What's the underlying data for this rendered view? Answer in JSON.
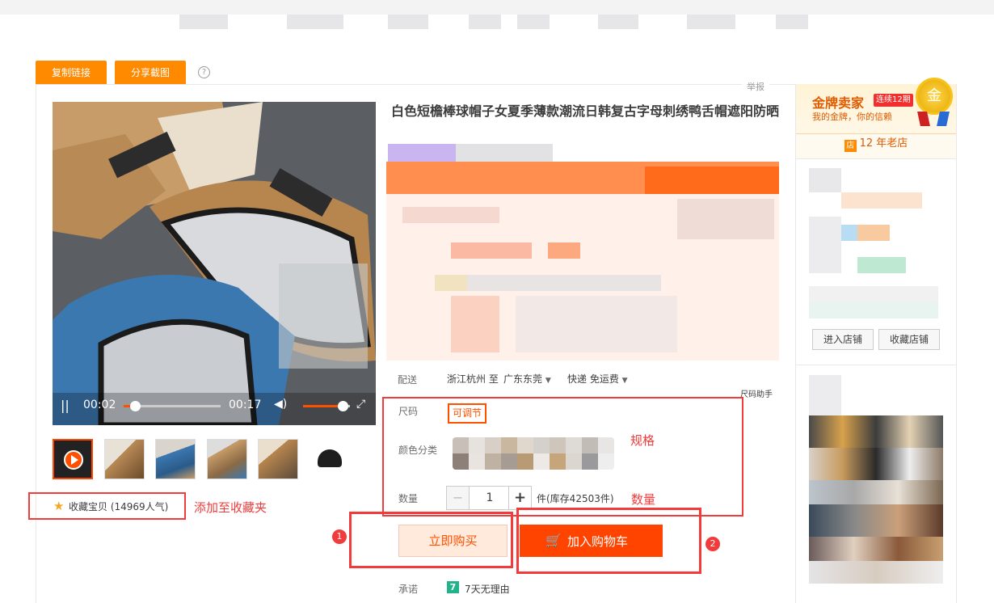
{
  "toolbar": {
    "copy_link_label": "复制链接",
    "share_screenshot_label": "分享截图",
    "help_glyph": "?",
    "report_label": "举报"
  },
  "video": {
    "current_time": "00:02",
    "total_time": "00:17",
    "progress": 0.12,
    "volume": 0.85,
    "play_icon": "pause-icon"
  },
  "product": {
    "title": "白色短檐棒球帽子女夏季薄款潮流日韩复古字母刺绣鸭舌帽遮阳防晒",
    "shipping_label": "配送",
    "ship_from": "浙江杭州 至",
    "ship_to": "广东东莞",
    "ship_method": "快递 免运费",
    "size_helper": "尺码助手",
    "size_label": "尺码",
    "size_option": "可调节",
    "color_label": "颜色分类",
    "quantity_label": "数量",
    "quantity_value": "1",
    "minus": "−",
    "plus": "+",
    "stock_text": "件(库存42503件)",
    "buy_now_label": "立即购买",
    "add_cart_label": "加入购物车",
    "promise_label": "承诺",
    "promise_badge": "7",
    "promise_text": "7天无理由"
  },
  "favorite": {
    "text": "收藏宝贝 (14969人气)"
  },
  "annotations": {
    "favorite_note": "添加至收藏夹",
    "spec_note": "规格",
    "quantity_note": "数量",
    "badge_1": "1",
    "badge_2": "2"
  },
  "seller": {
    "medal_title": "金牌卖家",
    "streak": "连续12期",
    "slogan": "我的金牌，你的信赖",
    "medal_glyph": "金",
    "store_icon_glyph": "店",
    "store_age": "12 年老店",
    "enter_store_label": "进入店铺",
    "collect_store_label": "收藏店铺"
  },
  "colors": {
    "accent_orange": "#ff8a00",
    "cart_red": "#ff3e00",
    "annotation_red": "#f23b3b",
    "buy_now_bg": "#ffeadb",
    "buy_now_text": "#f40"
  }
}
